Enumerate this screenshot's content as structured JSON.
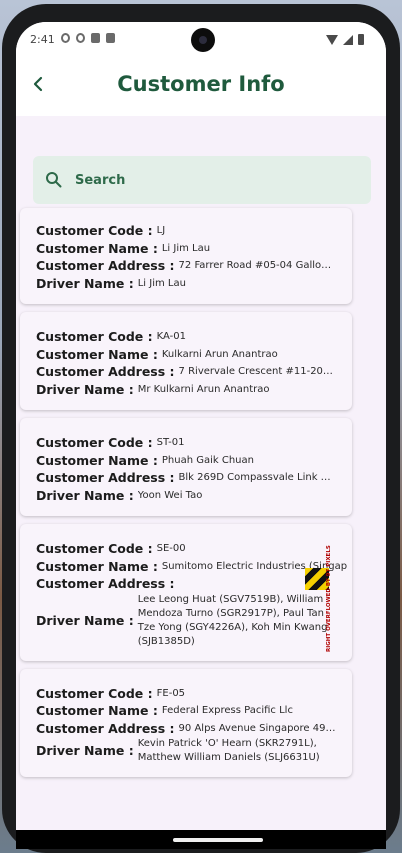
{
  "status_bar": {
    "time": "2:41"
  },
  "app_bar": {
    "title": "Customer Info"
  },
  "search": {
    "placeholder": "Search"
  },
  "labels": {
    "code": "Customer Code :",
    "name": "Customer Name :",
    "address": "Customer Address :",
    "driver": "Driver Name :"
  },
  "customers": [
    {
      "code": "LJ",
      "name": "Li Jim Lau",
      "address": "72 Farrer Road #05-04 Gallop …",
      "driver": "Li Jim Lau"
    },
    {
      "code": "KA-01",
      "name": "Kulkarni Arun Anantrao",
      "address": "7 Rivervale Crescent #11-20 Riv…",
      "driver": "Mr Kulkarni Arun Anantrao"
    },
    {
      "code": "ST-01",
      "name": "Phuah Gaik Chuan",
      "address": "Blk 269D Compassvale Link #12…",
      "driver": "Yoon Wei Tao"
    },
    {
      "code": "SE-00",
      "name": "Sumitomo Electric Industries (Singap",
      "address": "",
      "driver": "Lee Leong Huat (SGV7519B), William Mendoza Turno (SGR2917P), Paul Tan Tze Yong (SGY4226A), Koh Min Kwang (SJB1385D)"
    },
    {
      "code": "FE-05",
      "name": "Federal Express Pacific Llc",
      "address": "90 Alps Avenue Singapore 498…",
      "driver": "Kevin Patrick 'O' Hearn (SKR2791L), Matthew William Daniels (SLJ6631U)"
    }
  ],
  "debug_overlay": {
    "text": "RIGHT OVERFLOWED BY 97 PIXELS"
  },
  "colors": {
    "accent": "#1f5a3d",
    "search_bg": "#e3efe8",
    "page_bg": "#f7f1fa"
  }
}
